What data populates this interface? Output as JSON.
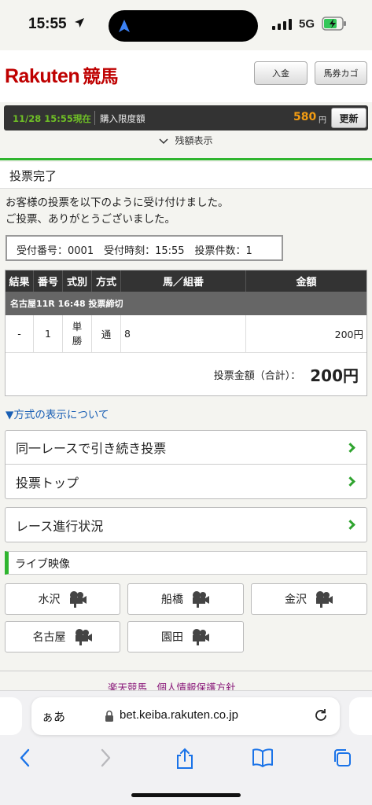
{
  "status": {
    "time": "15:55",
    "network": "5G"
  },
  "header": {
    "logo_main": "Rakuten",
    "logo_sub": "競馬",
    "deposit_label": "入金",
    "cart_label": "馬券カゴ"
  },
  "balance": {
    "timestamp": "11/28 15:55現在",
    "limit_label": "購入限度額",
    "amount": "580",
    "unit": "円",
    "refresh_label": "更新",
    "toggle_label": "残額表示"
  },
  "page": {
    "title": "投票完了",
    "message_line1": "お客様の投票を以下のように受け付けました。",
    "message_line2": "ご投票、ありがとうございました。",
    "receipt": "受付番号：0001　受付時刻：15:55　投票件数：1"
  },
  "table": {
    "headers": [
      "結果",
      "番号",
      "式別",
      "方式",
      "馬／組番",
      "金額"
    ],
    "race": "名古屋11R 16:48 投票締切",
    "row": {
      "result": "-",
      "number": "1",
      "bet_type_1": "単",
      "bet_type_2": "勝",
      "method": "通",
      "combo": "8",
      "amount": "200円"
    },
    "total_label": "投票金額（合計）：",
    "total_value": "200円"
  },
  "method_link": "▼方式の表示について",
  "menu": {
    "same_race": "同一レースで引き続き投票",
    "top": "投票トップ",
    "progress": "レース進行状況"
  },
  "live": {
    "title": "ライブ映像",
    "tracks": [
      "水沢",
      "船橋",
      "金沢",
      "名古屋",
      "園田"
    ]
  },
  "footer_peek": "楽天競馬　個人情報保護方針",
  "safari": {
    "aa_label": "ぁあ",
    "url": "bet.keiba.rakuten.co.jp"
  },
  "colors": {
    "brand": "#bf0000",
    "accent_green": "#2fb52f",
    "amount_orange": "#f39c12",
    "link_blue": "#1a5fb4"
  }
}
